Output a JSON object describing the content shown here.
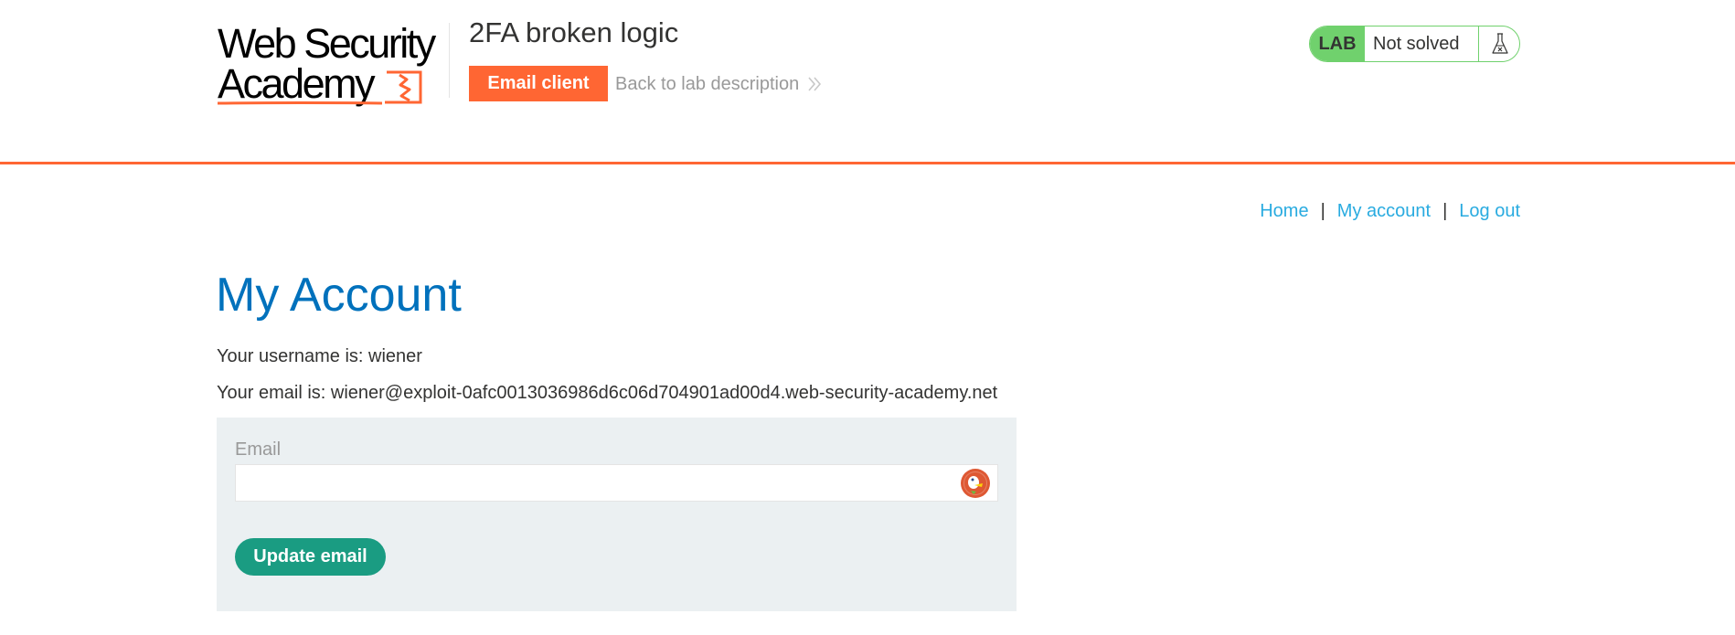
{
  "header": {
    "logo": {
      "line1": "Web Security",
      "line2": "Academy"
    },
    "lab_title": "2FA broken logic",
    "email_client_label": "Email client",
    "back_link_label": "Back to lab description"
  },
  "lab_status": {
    "tag": "LAB",
    "status": "Not solved",
    "icon": "flask-icon",
    "colors": {
      "badge_green": "#70d16d"
    }
  },
  "nav": {
    "home": "Home",
    "separator": "|",
    "my_account": "My account",
    "log_out": "Log out"
  },
  "main": {
    "title": "My Account",
    "username_text": "Your username is: wiener",
    "email_text": "Your email is: wiener@exploit-0afc0013036986d6c06d704901ad00d4.web-security-academy.net",
    "form": {
      "email_label": "Email",
      "email_value": "",
      "email_placeholder": "",
      "autofill_icon": "duckduckgo-icon",
      "submit_label": "Update email"
    }
  },
  "colors": {
    "accent_orange": "#ff6633",
    "title_blue": "#0071bc",
    "link_blue": "#29abe0",
    "button_green": "#1a9c82",
    "panel_bg": "#ebf0f2"
  }
}
